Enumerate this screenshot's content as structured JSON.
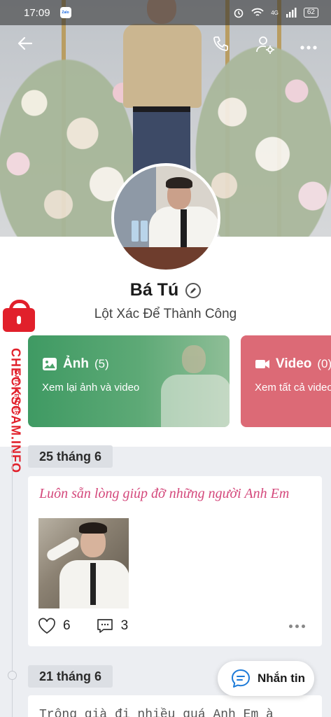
{
  "status_bar": {
    "time": "17:09",
    "app_badge": "Zalo",
    "network": "4G",
    "battery": "62"
  },
  "profile": {
    "name": "Bá Tú",
    "bio": "Lột Xác Để Thành Công"
  },
  "media_cards": [
    {
      "label": "Ảnh",
      "count": "(5)",
      "subtitle": "Xem lại ảnh và video",
      "color": "#4da46c"
    },
    {
      "label": "Video",
      "count": "(0)",
      "subtitle": "Xem tất cả video",
      "color": "#dc6a76"
    }
  ],
  "watermark": {
    "brand": "CHECKSCAM.INFO",
    "sub": "DATA CENTER"
  },
  "timeline": [
    {
      "date": "25 tháng 6",
      "caption": "Luôn sẵn lòng giúp đỡ những người Anh Em",
      "likes": "6",
      "comments": "3"
    },
    {
      "date": "21 tháng 6",
      "caption": "Trông già đi nhiều quá Anh Em à"
    }
  ],
  "message_button": {
    "label": "Nhắn tin"
  },
  "colors": {
    "accent_pink": "#d4487b",
    "photo_card": "#4da46c",
    "video_card": "#dc6a76",
    "watermark_red": "#e1202b"
  }
}
